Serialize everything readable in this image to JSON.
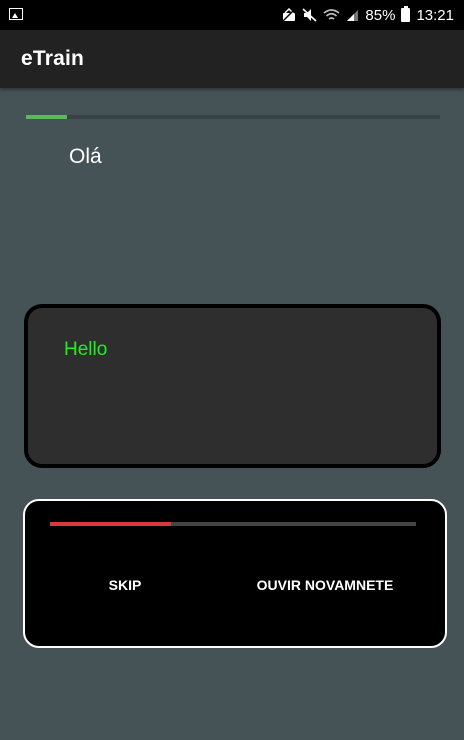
{
  "status_bar": {
    "battery_percent": "85%",
    "time": "13:21",
    "icons": [
      "gallery-icon",
      "alarm-icon",
      "mute-icon",
      "wifi-icon",
      "signal-icon",
      "battery-icon"
    ]
  },
  "app_bar": {
    "title": "eTrain"
  },
  "lesson": {
    "progress": 0.1,
    "prompt": "Olá",
    "answer": "Hello"
  },
  "audio_panel": {
    "progress": 0.33,
    "skip_label": "SKIP",
    "replay_label": "OUVIR NOVAMNETE"
  },
  "colors": {
    "background": "#455357",
    "app_bar": "#222222",
    "lesson_progress": "#5cb85c",
    "answer_text": "#22ee22",
    "audio_progress": "#d9383c",
    "card": "#2e2e2e"
  }
}
